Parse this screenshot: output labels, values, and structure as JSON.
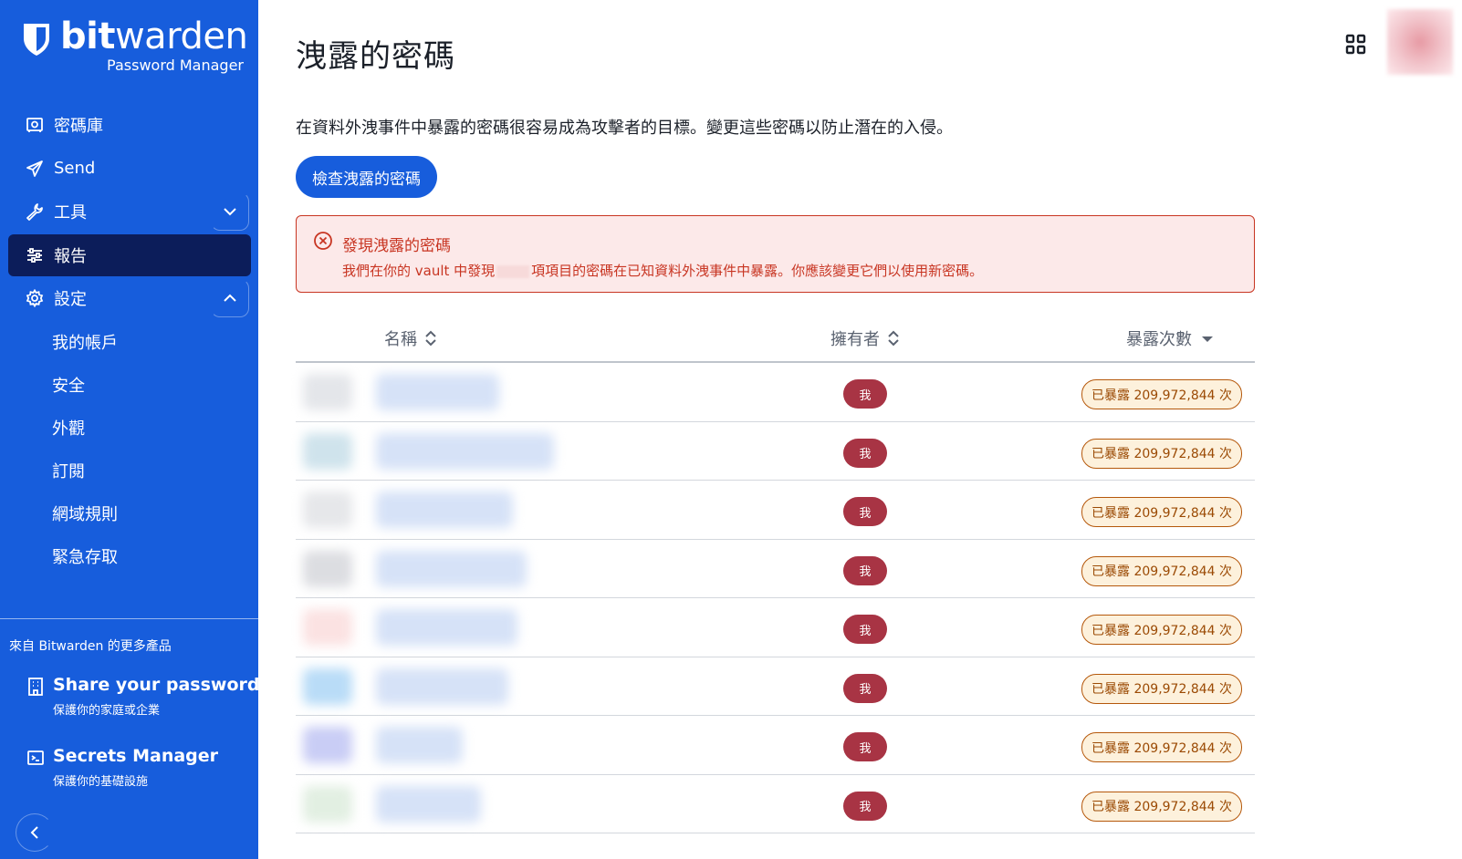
{
  "brand": {
    "name_bold": "bit",
    "name_light": "warden",
    "subtitle": "Password Manager"
  },
  "nav": {
    "items": [
      {
        "label": "密碼庫",
        "icon": "vault-icon"
      },
      {
        "label": "Send",
        "icon": "send-icon"
      },
      {
        "label": "工具",
        "icon": "wrench-icon",
        "expanded": false
      },
      {
        "label": "報告",
        "icon": "sliders-icon",
        "active": true
      },
      {
        "label": "設定",
        "icon": "gear-icon",
        "expanded": true
      }
    ],
    "settings_sub": [
      "我的帳戶",
      "安全",
      "外觀",
      "訂閱",
      "網域規則",
      "緊急存取"
    ]
  },
  "more_products": {
    "title": "來自 Bitwarden 的更多產品",
    "items": [
      {
        "name": "Share your passwords",
        "desc": "保護你的家庭或企業",
        "icon": "building-icon"
      },
      {
        "name": "Secrets Manager",
        "desc": "保護你的基礎設施",
        "icon": "terminal-icon"
      }
    ]
  },
  "page": {
    "title": "洩露的密碼",
    "description": "在資料外洩事件中暴露的密碼很容易成為攻擊者的目標。變更這些密碼以防止潛在的入侵。",
    "check_button": "檢查洩露的密碼"
  },
  "alert": {
    "title": "發現洩露的密碼",
    "body_before": "我們在你的 vault 中發現",
    "body_after": "項項目的密碼在已知資料外洩事件中暴露。你應該變更它們以使用新密碼。"
  },
  "table": {
    "headers": {
      "name": "名稱",
      "owner": "擁有者",
      "exposed": "暴露次數"
    },
    "rows": [
      {
        "owner": "我",
        "exposed": "已暴露 209,972,844 次"
      },
      {
        "owner": "我",
        "exposed": "已暴露 209,972,844 次"
      },
      {
        "owner": "我",
        "exposed": "已暴露 209,972,844 次"
      },
      {
        "owner": "我",
        "exposed": "已暴露 209,972,844 次"
      },
      {
        "owner": "我",
        "exposed": "已暴露 209,972,844 次"
      },
      {
        "owner": "我",
        "exposed": "已暴露 209,972,844 次"
      },
      {
        "owner": "我",
        "exposed": "已暴露 209,972,844 次"
      },
      {
        "owner": "我",
        "exposed": "已暴露 209,972,844 次"
      }
    ]
  },
  "colors": {
    "sidebar": "#175ddc",
    "sidebar_active": "#0c1d5a",
    "primary_button": "#175ddc",
    "alert_border": "#c83522",
    "alert_bg": "#fce9e9",
    "owner_badge": "#a83444",
    "exposed_badge_bg": "#fdf1dc",
    "exposed_badge_border": "#b5580b"
  }
}
